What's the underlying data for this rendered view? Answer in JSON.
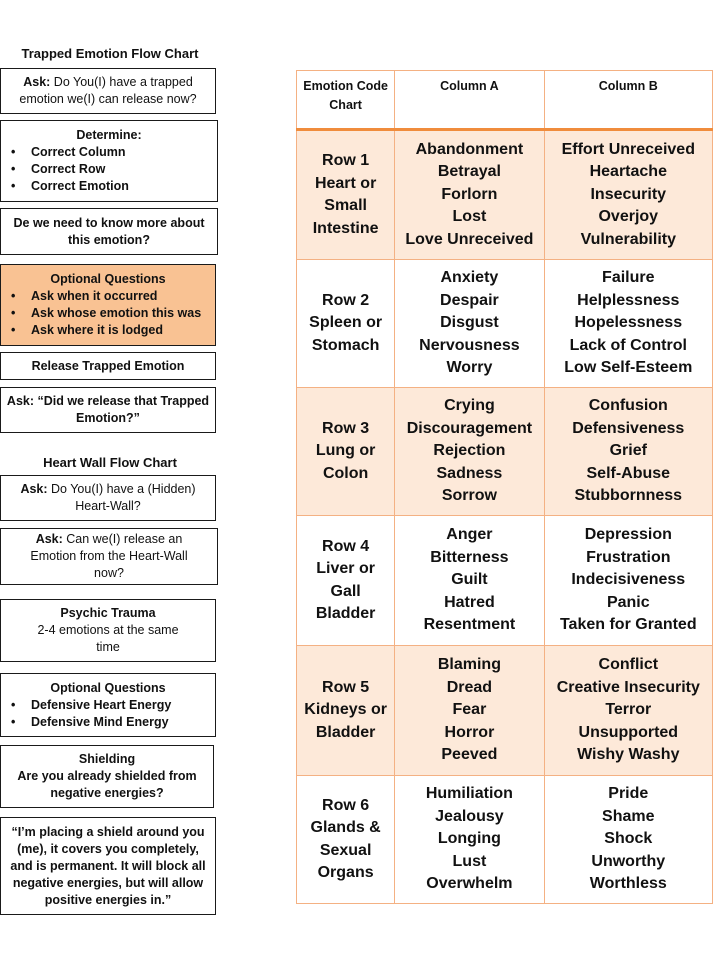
{
  "trapped_flow": {
    "title": "Trapped Emotion Flow Chart",
    "ask1": {
      "label": "Ask:",
      "text": " Do You(I) have a trapped emotion we(I) can release now?"
    },
    "determine": {
      "title": "Determine:",
      "items": [
        "Correct Column",
        "Correct Row",
        "Correct Emotion"
      ]
    },
    "know_more": "De we need to know more about this emotion?",
    "optional": {
      "title": "Optional Questions",
      "items": [
        "Ask when it occurred",
        "Ask whose emotion this was",
        "Ask where it is lodged"
      ]
    },
    "release": "Release Trapped Emotion",
    "ask_released": "Ask: “Did we release that Trapped Emotion?”"
  },
  "heart_wall_flow": {
    "title": "Heart Wall Flow Chart",
    "ask1": {
      "label": "Ask:",
      "text": " Do You(I) have a (Hidden) Heart-Wall?"
    },
    "ask2": {
      "label": "Ask:",
      "text": " Can we(I) release an Emotion from the Heart-Wall  now?"
    },
    "psychic": {
      "title": "Psychic Trauma",
      "text": "2-4 emotions at the same time"
    },
    "optional": {
      "title": "Optional Questions",
      "items": [
        "Defensive Heart Energy",
        "Defensive Mind Energy"
      ]
    },
    "shielding": {
      "title": "Shielding",
      "text": "Are you already shielded from negative energies?"
    },
    "shield_statement": "“I’m placing a shield around you (me), it covers you completely, and is permanent. It will block all negative energies, but will allow positive energies in.”"
  },
  "emotion_chart": {
    "headers": [
      "Emotion Code Chart",
      "Column A",
      "Column B"
    ],
    "rows": [
      {
        "label": [
          "Row 1",
          "Heart or",
          "Small",
          "Intestine"
        ],
        "a": [
          "Abandonment",
          "Betrayal",
          "Forlorn",
          "Lost",
          "Love Unreceived"
        ],
        "b": [
          "Effort Unreceived",
          "Heartache",
          "Insecurity",
          "Overjoy",
          "Vulnerability"
        ]
      },
      {
        "label": [
          "Row 2",
          "Spleen or",
          "Stomach"
        ],
        "a": [
          "Anxiety",
          "Despair",
          "Disgust",
          "Nervousness",
          "Worry"
        ],
        "b": [
          "Failure",
          "Helplessness",
          "Hopelessness",
          "Lack of Control",
          "Low Self-Esteem"
        ]
      },
      {
        "label": [
          "Row 3",
          "Lung or",
          "Colon"
        ],
        "a": [
          "Crying",
          "Discouragement",
          "Rejection",
          "Sadness",
          "Sorrow"
        ],
        "b": [
          "Confusion",
          "Defensiveness",
          "Grief",
          "Self-Abuse",
          "Stubbornness"
        ]
      },
      {
        "label": [
          "Row 4",
          "Liver or",
          "Gall",
          "Bladder"
        ],
        "a": [
          "Anger",
          "Bitterness",
          "Guilt",
          "Hatred",
          "Resentment"
        ],
        "b": [
          "Depression",
          "Frustration",
          "Indecisiveness",
          "Panic",
          "Taken for Granted"
        ]
      },
      {
        "label": [
          "Row 5",
          "Kidneys or",
          "Bladder"
        ],
        "a": [
          "Blaming",
          "Dread",
          "Fear",
          "Horror",
          "Peeved"
        ],
        "b": [
          "Conflict",
          "Creative Insecurity",
          "Terror",
          "Unsupported",
          "Wishy Washy"
        ]
      },
      {
        "label": [
          "Row 6",
          "Glands &",
          "Sexual",
          "Organs"
        ],
        "a": [
          "Humiliation",
          "Jealousy",
          "Longing",
          "Lust",
          "Overwhelm"
        ],
        "b": [
          "Pride",
          "Shame",
          "Shock",
          "Unworthy",
          "Worthless"
        ]
      }
    ]
  },
  "colors": {
    "accent_fill": "#f9c293",
    "row_shade": "#fde9d9",
    "table_border": "#f4b183",
    "header_rule": "#f08c3c"
  }
}
